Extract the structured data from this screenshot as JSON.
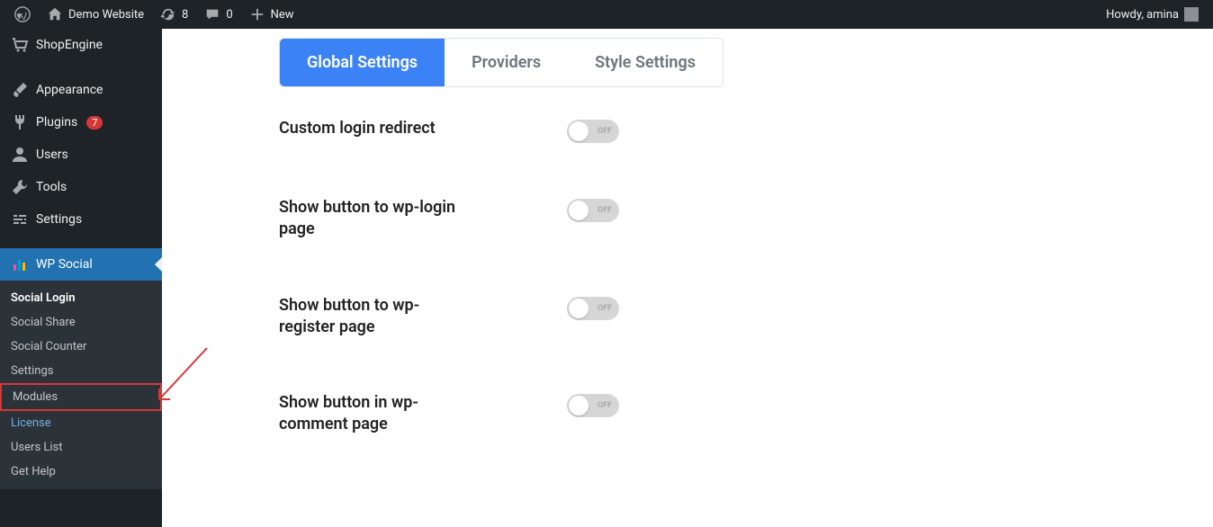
{
  "adminbar": {
    "site_title": "Demo Website",
    "updates": "8",
    "comments": "0",
    "new_label": "New",
    "howdy": "Howdy, amina"
  },
  "sidebar": {
    "main_items": [
      {
        "label": "ShopEngine",
        "icon": "cart"
      },
      {
        "label": "Appearance",
        "icon": "brush"
      },
      {
        "label": "Plugins",
        "icon": "plug",
        "badge": "7"
      },
      {
        "label": "Users",
        "icon": "user"
      },
      {
        "label": "Tools",
        "icon": "wrench"
      },
      {
        "label": "Settings",
        "icon": "sliders"
      }
    ],
    "active_item": "WP Social",
    "submenu": [
      {
        "label": "Social Login",
        "current": true
      },
      {
        "label": "Social Share"
      },
      {
        "label": "Social Counter"
      },
      {
        "label": "Settings"
      },
      {
        "label": "Modules",
        "highlight": true
      },
      {
        "label": "License",
        "link": true
      },
      {
        "label": "Users List"
      },
      {
        "label": "Get Help"
      }
    ]
  },
  "tabs": [
    {
      "label": "Global Settings",
      "active": true
    },
    {
      "label": "Providers"
    },
    {
      "label": "Style Settings"
    }
  ],
  "settings": [
    {
      "label": "Custom login redirect",
      "state": "OFF"
    },
    {
      "label": "Show button to wp-login page",
      "state": "OFF"
    },
    {
      "label": "Show button to wp-register page",
      "state": "OFF"
    },
    {
      "label": "Show button in wp-comment page",
      "state": "OFF"
    }
  ]
}
